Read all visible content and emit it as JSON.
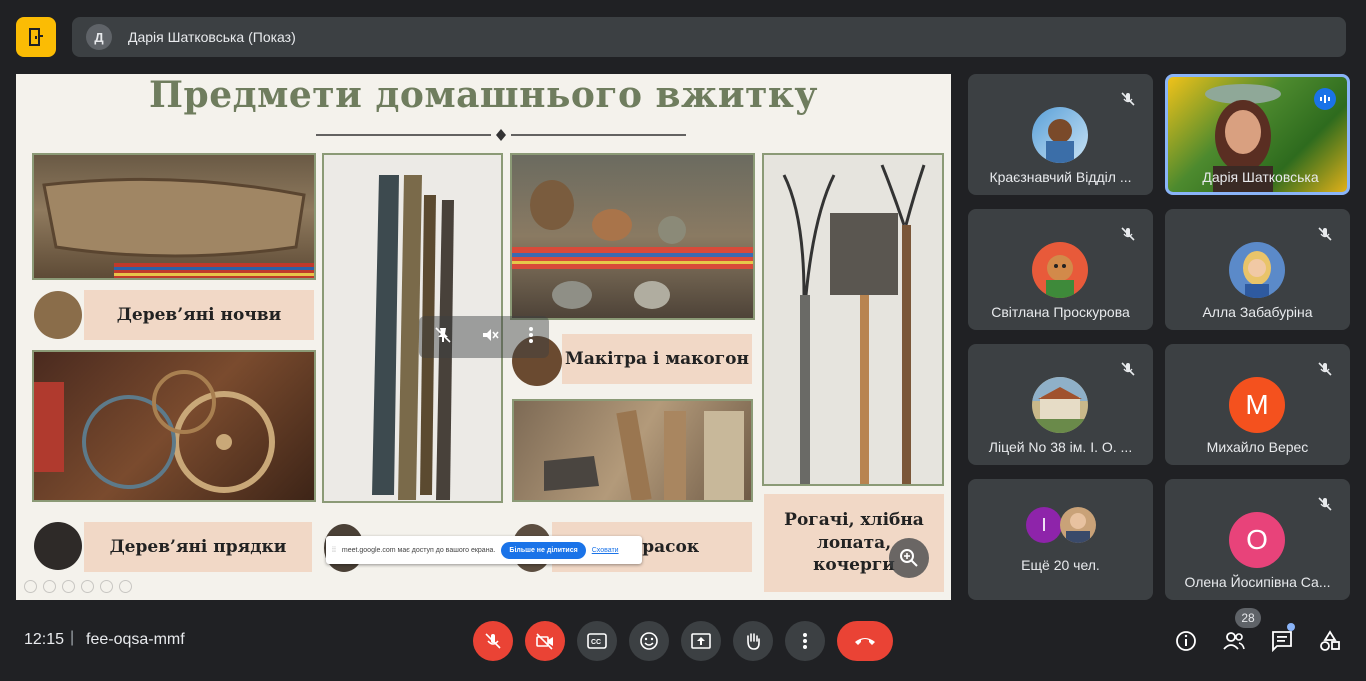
{
  "presenting": {
    "initial": "Д",
    "label": "Дарія Шатковська (Показ)"
  },
  "slide": {
    "title": "Предмети домашнього вжитку",
    "labels": {
      "nochvy": "Дерев’яні ночви",
      "pryadky": "Дерев’яні прядки",
      "makitra": "Макітра і макогон",
      "prasok": "ія прасок",
      "rogachi": "Рогачі, хлібна лопата, кочерги"
    },
    "share_banner": {
      "text": "meet.google.com має доступ до вашого екрана.",
      "stop_label": "Більше не ділитися",
      "hide_label": "Сховати"
    }
  },
  "participants": [
    {
      "name": "Краєзнавчий Відділ ...",
      "muted": true
    },
    {
      "name": "Дарія Шатковська",
      "muted": false,
      "speaking": true
    },
    {
      "name": "Світлана Проскурова",
      "muted": true
    },
    {
      "name": "Алла Забабуріна",
      "muted": true
    },
    {
      "name": "Ліцей No 38 ім. І. О. ...",
      "muted": true
    },
    {
      "name": "Михайло Верес",
      "initial": "М",
      "avatar_color": "#f4511e",
      "muted": true
    },
    {
      "name": "Ещё 20 чел.",
      "initial": "I",
      "avatar_color": "#8e24aa"
    },
    {
      "name": "Олена Йосипівна Са...",
      "initial": "О",
      "avatar_color": "#e8437a",
      "muted": true
    }
  ],
  "footer": {
    "time": "12:15",
    "separator": "|",
    "meeting_code": "fee-oqsa-mmf",
    "participant_count": "28"
  },
  "colors": {
    "accent": "#8ab4f8",
    "danger": "#ea4335",
    "tile": "#3c4043",
    "background": "#202124"
  }
}
